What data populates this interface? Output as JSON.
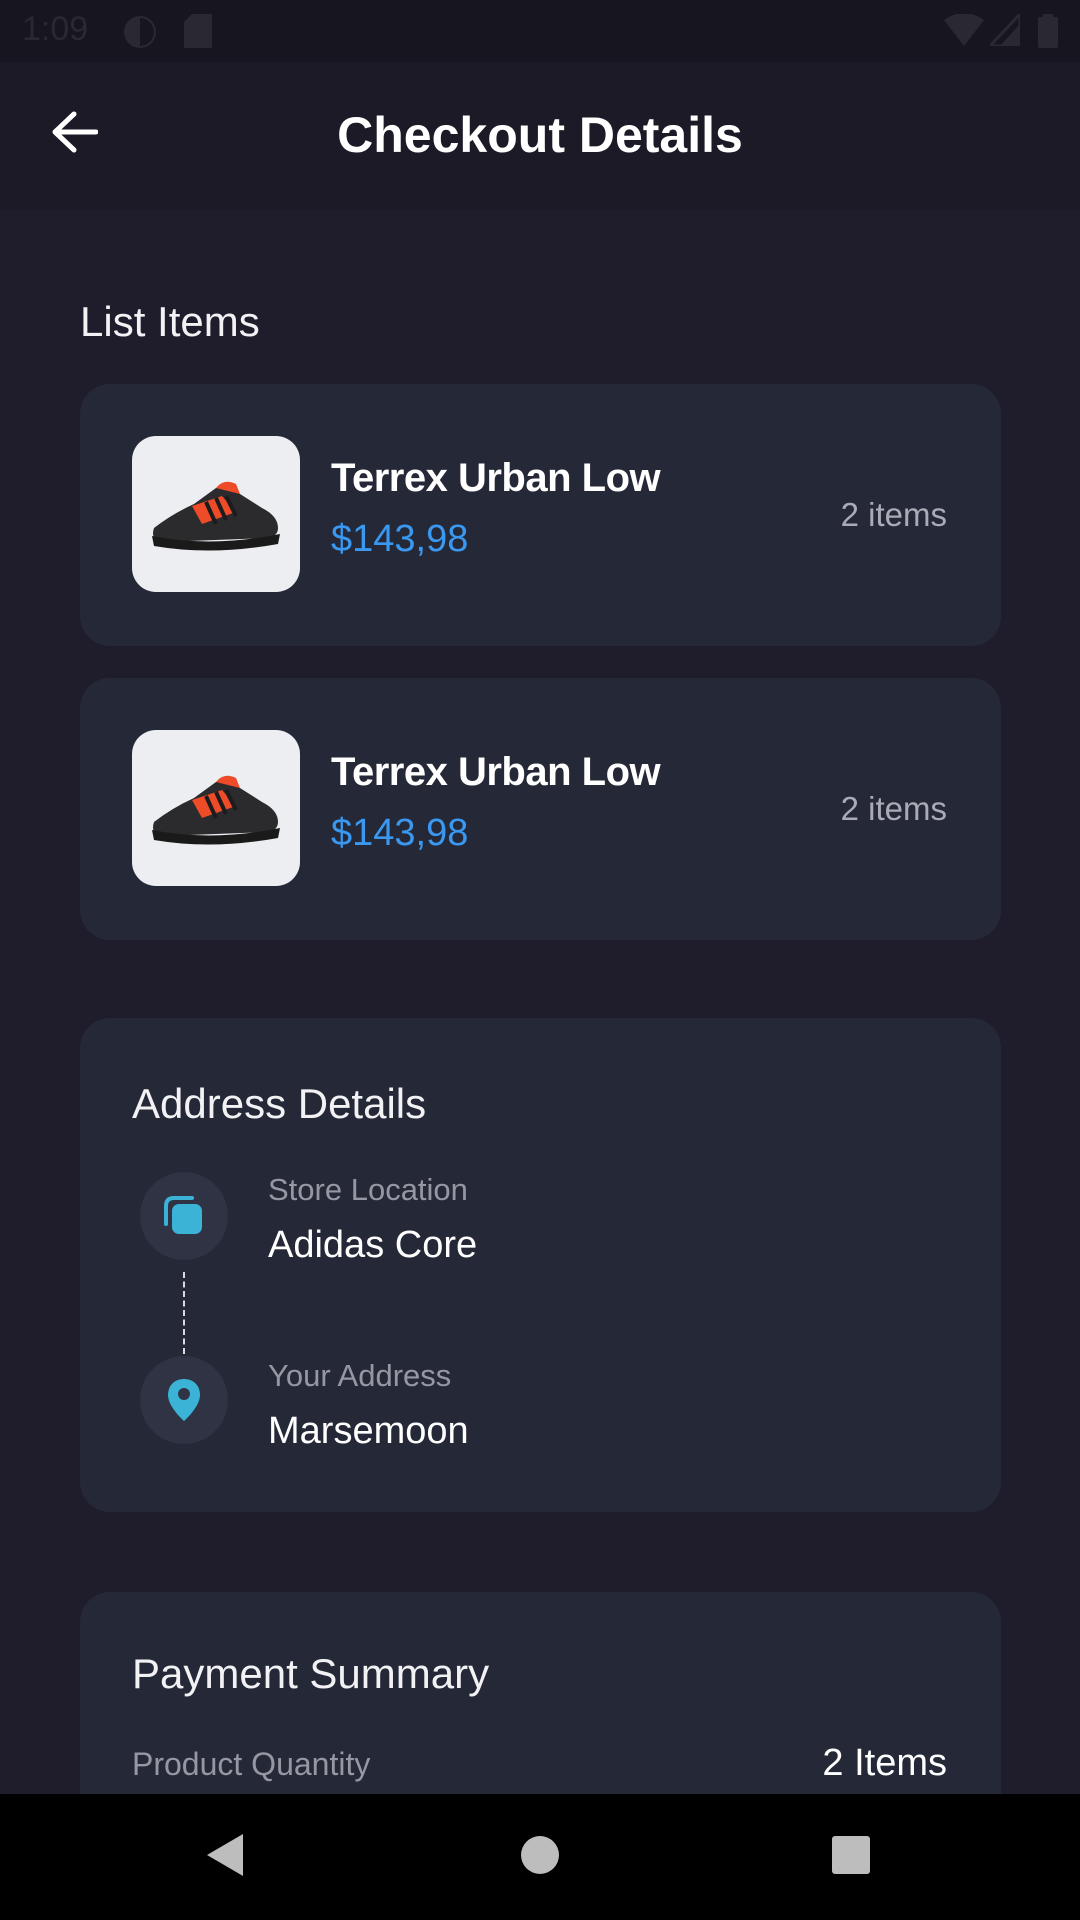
{
  "status_bar": {
    "time": "1:09"
  },
  "header": {
    "title": "Checkout Details",
    "back_icon": "arrow-left-icon"
  },
  "list_items": {
    "title": "List Items",
    "items": [
      {
        "name": "Terrex Urban Low",
        "price": "$143,98",
        "quantity": "2 items"
      },
      {
        "name": "Terrex Urban Low",
        "price": "$143,98",
        "quantity": "2 items"
      }
    ]
  },
  "address": {
    "title": "Address Details",
    "store_label": "Store Location",
    "store_value": "Adidas Core",
    "user_label": "Your Address",
    "user_value": "Marsemoon"
  },
  "payment": {
    "title": "Payment Summary",
    "rows": [
      {
        "label": "Product Quantity",
        "value": "2 Items"
      }
    ]
  },
  "colors": {
    "background": "#1f1d2b",
    "card": "#252837",
    "price_blue": "#3a98f0",
    "accent_teal": "#3bb3d6"
  }
}
